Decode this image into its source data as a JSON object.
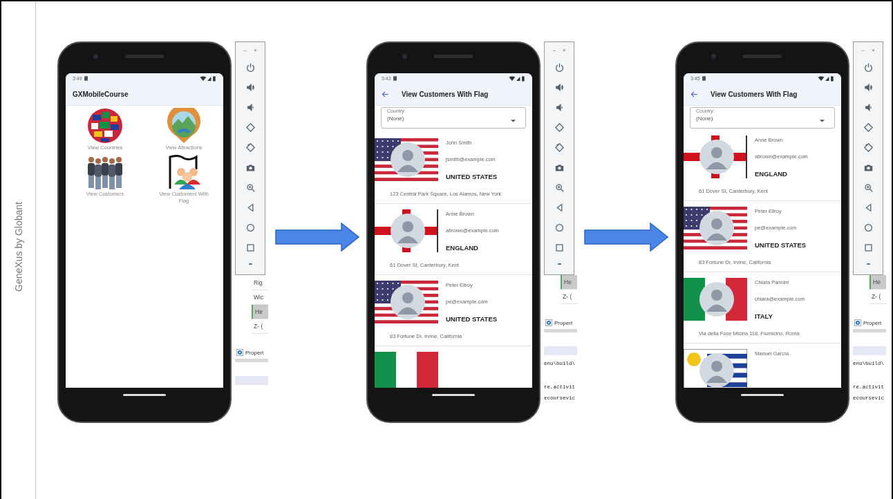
{
  "brand": "GeneXus by Globant",
  "panels": [
    {
      "kind": "menu",
      "status_time": "3:49",
      "title": "GXMobileCourse",
      "items": [
        {
          "label": "View Countries"
        },
        {
          "label": "View Attractions"
        },
        {
          "label": "View Customers"
        },
        {
          "label": "View Customers With Flag"
        }
      ],
      "toolbar": {
        "minimize": "–",
        "close": "×",
        "more": "•••"
      },
      "property_rows": [
        {
          "text": "Rig",
          "selected": false
        },
        {
          "text": "Wic",
          "selected": false
        },
        {
          "text": "He",
          "selected": true
        },
        {
          "text": "Z- (",
          "selected": false
        }
      ],
      "properties_tab": "Propert"
    },
    {
      "kind": "list",
      "status_time": "3:43",
      "title": "View Customers With Flag",
      "filter": {
        "label": "Country:",
        "value": "(None)"
      },
      "customers": [
        {
          "kind": "us",
          "name": "John Smith",
          "email": "jsmith@example.com",
          "country": "UNITED STATES",
          "address": "123 Central Park Square, Los Alamos, New York"
        },
        {
          "kind": "england",
          "name": "Anne Brown",
          "email": "abrown@example.com",
          "country": "ENGLAND",
          "address": "61 Dover St, Canterbury, Kent"
        },
        {
          "kind": "us",
          "name": "Peter Ellroy",
          "email": "pe@example.com",
          "country": "UNITED STATES",
          "address": "83 Fortune Dr, Irvine, California"
        },
        {
          "kind": "italy"
        }
      ],
      "toolbar": {
        "minimize": "–",
        "close": "×",
        "more": "•••"
      },
      "property_rows": [
        {
          "text": "He",
          "selected": true
        },
        {
          "text": "Z- (",
          "selected": false
        }
      ],
      "properties_tab": "Propert",
      "code_lines": [
        "enu\\build\\",
        "re.activit",
        "ecoursevic"
      ]
    },
    {
      "kind": "list",
      "status_time": "3:45",
      "title": "View Customers With Flag",
      "filter": {
        "label": "Country:",
        "value": "(None)"
      },
      "customers": [
        {
          "kind": "england",
          "name": "Anne Brown",
          "email": "abrown@example.com",
          "country": "ENGLAND",
          "address": "61 Dover St, Canterbury, Kent"
        },
        {
          "kind": "us",
          "name": "Peter Ellroy",
          "email": "pe@example.com",
          "country": "UNITED STATES",
          "address": "83 Fortune Dr, Irvine, California"
        },
        {
          "kind": "italy",
          "name": "Chiara Pannini",
          "email": "chiara@example.com",
          "country": "ITALY",
          "address": "Via della Foce Micina 118, Fiumicino, Roma"
        },
        {
          "kind": "uruguay",
          "name": "Manuel García"
        }
      ],
      "toolbar": {
        "minimize": "–",
        "close": "×",
        "more": "•••"
      },
      "property_rows": [
        {
          "text": "He",
          "selected": true
        },
        {
          "text": "Z- (",
          "selected": false
        }
      ],
      "properties_tab": "Propert",
      "code_lines": [
        "enu\\build\\",
        "re.activit",
        "ecoursevic"
      ]
    }
  ]
}
